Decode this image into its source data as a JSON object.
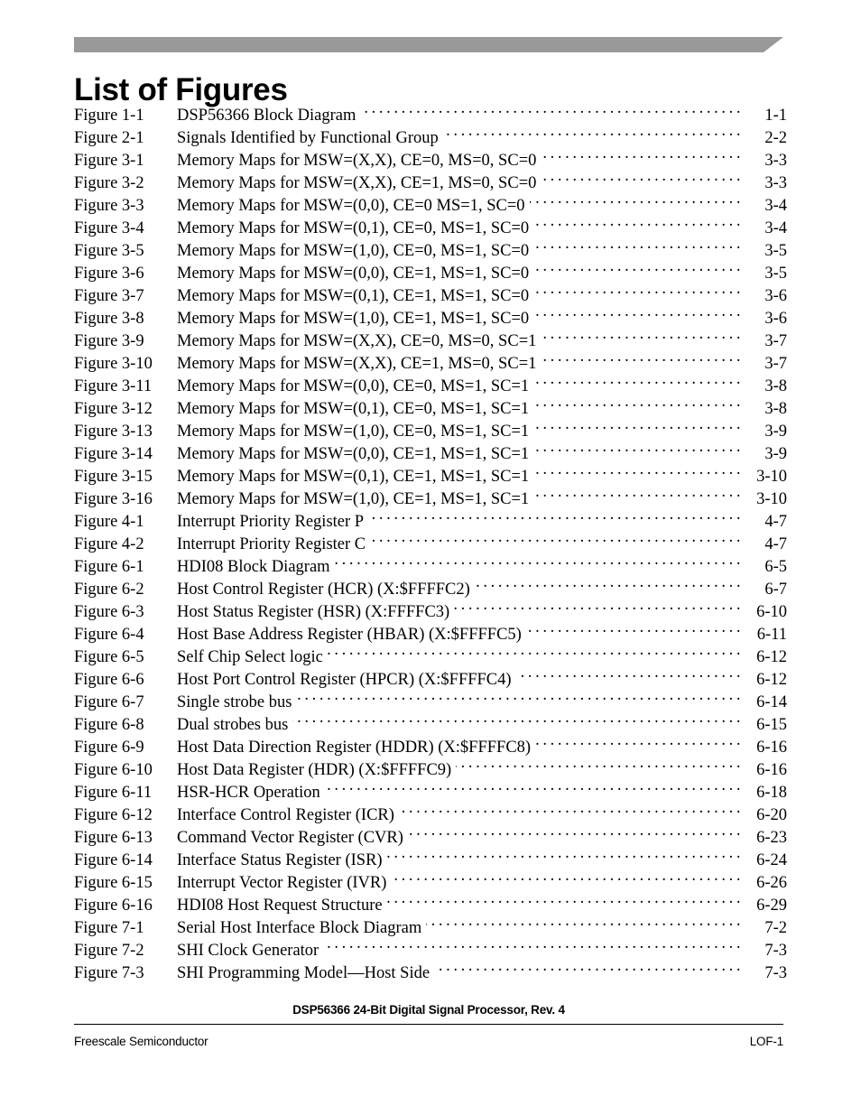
{
  "header": {
    "bar_color": "#999999",
    "title": "List of Figures"
  },
  "figures": [
    {
      "label": "Figure 1-1",
      "title": "DSP56366 Block Diagram",
      "page": "1-1"
    },
    {
      "label": "Figure 2-1",
      "title": "Signals Identified by Functional Group",
      "page": "2-2"
    },
    {
      "label": "Figure 3-1",
      "title": "Memory Maps for MSW=(X,X), CE=0, MS=0, SC=0",
      "page": "3-3"
    },
    {
      "label": "Figure 3-2",
      "title": "Memory Maps for MSW=(X,X), CE=1, MS=0, SC=0",
      "page": "3-3"
    },
    {
      "label": "Figure 3-3",
      "title": "Memory Maps for MSW=(0,0), CE=0 MS=1, SC=0",
      "page": "3-4"
    },
    {
      "label": "Figure 3-4",
      "title": "Memory Maps for MSW=(0,1), CE=0, MS=1, SC=0",
      "page": "3-4"
    },
    {
      "label": "Figure 3-5",
      "title": "Memory Maps for MSW=(1,0), CE=0, MS=1, SC=0",
      "page": "3-5"
    },
    {
      "label": "Figure 3-6",
      "title": "Memory Maps for MSW=(0,0), CE=1, MS=1, SC=0",
      "page": "3-5"
    },
    {
      "label": "Figure 3-7",
      "title": "Memory Maps for MSW=(0,1), CE=1, MS=1, SC=0",
      "page": "3-6"
    },
    {
      "label": "Figure 3-8",
      "title": "Memory Maps for MSW=(1,0), CE=1, MS=1, SC=0",
      "page": "3-6"
    },
    {
      "label": "Figure 3-9",
      "title": "Memory Maps for MSW=(X,X), CE=0, MS=0, SC=1",
      "page": "3-7"
    },
    {
      "label": "Figure 3-10",
      "title": "Memory Maps for MSW=(X,X), CE=1, MS=0, SC=1",
      "page": "3-7"
    },
    {
      "label": "Figure 3-11",
      "title": "Memory Maps for MSW=(0,0), CE=0, MS=1, SC=1",
      "page": "3-8"
    },
    {
      "label": "Figure 3-12",
      "title": "Memory Maps for MSW=(0,1), CE=0, MS=1, SC=1",
      "page": "3-8"
    },
    {
      "label": "Figure 3-13",
      "title": "Memory Maps for MSW=(1,0), CE=0, MS=1, SC=1",
      "page": "3-9"
    },
    {
      "label": "Figure 3-14",
      "title": "Memory Maps for MSW=(0,0), CE=1, MS=1, SC=1",
      "page": "3-9"
    },
    {
      "label": "Figure 3-15",
      "title": "Memory Maps for MSW=(0,1), CE=1, MS=1, SC=1",
      "page": "3-10"
    },
    {
      "label": "Figure 3-16",
      "title": "Memory Maps for MSW=(1,0), CE=1, MS=1, SC=1",
      "page": "3-10"
    },
    {
      "label": "Figure 4-1",
      "title": "Interrupt Priority Register P",
      "page": "4-7"
    },
    {
      "label": "Figure 4-2",
      "title": "Interrupt Priority Register C",
      "page": "4-7"
    },
    {
      "label": "Figure 6-1",
      "title": "HDI08 Block Diagram",
      "page": "6-5"
    },
    {
      "label": "Figure 6-2",
      "title": "Host Control Register (HCR) (X:$FFFFC2)",
      "page": "6-7"
    },
    {
      "label": "Figure 6-3",
      "title": "Host Status Register (HSR) (X:FFFFC3)",
      "page": "6-10"
    },
    {
      "label": "Figure 6-4",
      "title": "Host Base Address Register (HBAR) (X:$FFFFC5)",
      "page": "6-11"
    },
    {
      "label": "Figure 6-5",
      "title": "Self Chip Select logic",
      "page": "6-12"
    },
    {
      "label": "Figure 6-6",
      "title": "Host Port Control Register (HPCR) (X:$FFFFC4)",
      "page": "6-12"
    },
    {
      "label": "Figure 6-7",
      "title": "Single strobe bus",
      "page": "6-14"
    },
    {
      "label": "Figure 6-8",
      "title": "Dual strobes bus",
      "page": "6-15"
    },
    {
      "label": "Figure 6-9",
      "title": "Host Data Direction Register (HDDR) (X:$FFFFC8)",
      "page": "6-16"
    },
    {
      "label": "Figure 6-10",
      "title": "Host Data Register (HDR) (X:$FFFFC9)",
      "page": "6-16"
    },
    {
      "label": "Figure 6-11",
      "title": "HSR-HCR Operation",
      "page": "6-18"
    },
    {
      "label": "Figure 6-12",
      "title": "Interface Control Register (ICR)",
      "page": "6-20"
    },
    {
      "label": "Figure 6-13",
      "title": "Command Vector Register (CVR)",
      "page": "6-23"
    },
    {
      "label": "Figure 6-14",
      "title": "Interface Status Register (ISR)",
      "page": "6-24"
    },
    {
      "label": "Figure 6-15",
      "title": "Interrupt Vector Register (IVR)",
      "page": "6-26"
    },
    {
      "label": "Figure 6-16",
      "title": "HDI08 Host Request Structure",
      "page": "6-29"
    },
    {
      "label": "Figure 7-1",
      "title": "Serial Host Interface Block Diagram",
      "page": "7-2"
    },
    {
      "label": "Figure 7-2",
      "title": "SHI Clock Generator",
      "page": "7-3"
    },
    {
      "label": "Figure 7-3",
      "title": "SHI Programming Model—Host Side",
      "page": "7-3"
    }
  ],
  "footer": {
    "document_line": "DSP56366 24-Bit Digital Signal Processor, Rev. 4",
    "company": "Freescale Semiconductor",
    "page_number": "LOF-1"
  }
}
